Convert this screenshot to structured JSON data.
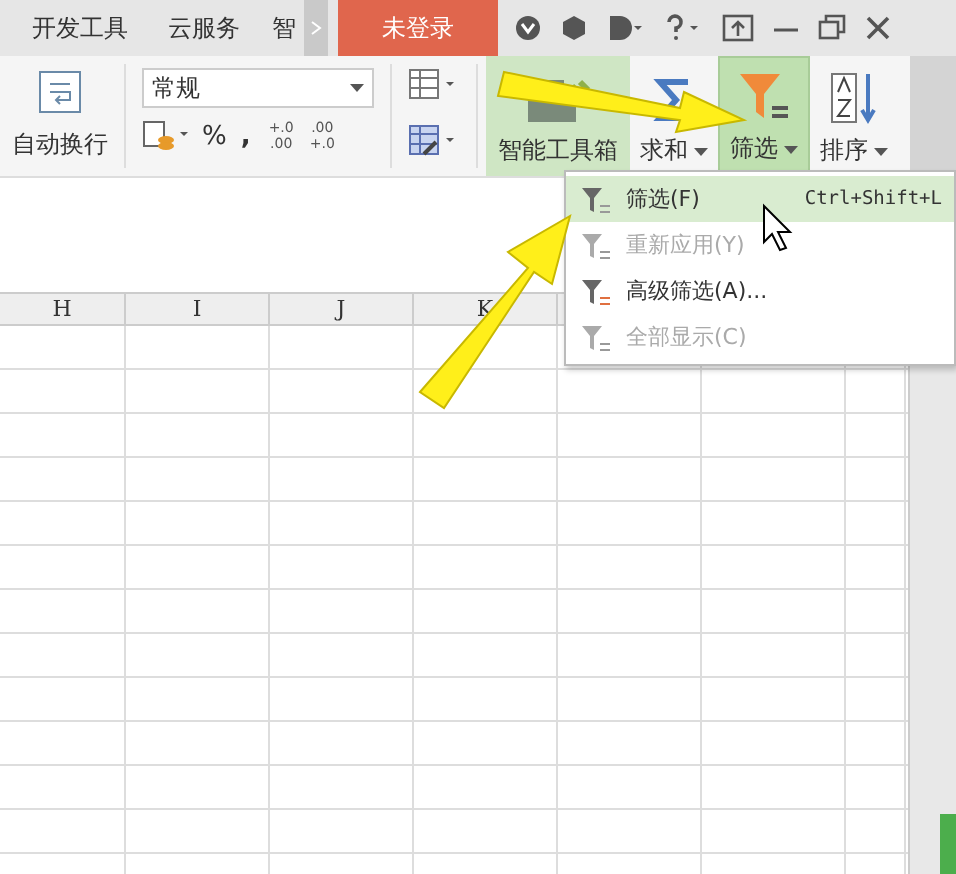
{
  "title_tabs": [
    {
      "label": "开发工具"
    },
    {
      "label": "云服务"
    },
    {
      "label": "智"
    }
  ],
  "login_button": "未登录",
  "ribbon": {
    "wrap_label": "自动换行",
    "number_format": "常规",
    "percent": "%",
    "comma": ",",
    "decimal_buttons": [
      {
        "top": "+.0",
        "bottom": ".00"
      },
      {
        "top": ".00",
        "bottom": "+.0"
      }
    ],
    "tools": [
      {
        "label": "智能工具箱",
        "kind": "toolbox",
        "selected": false
      },
      {
        "label": "求和",
        "kind": "sum",
        "selected": false
      },
      {
        "label": "筛选",
        "kind": "filter",
        "selected": true
      },
      {
        "label": "排序",
        "kind": "sort",
        "selected": false
      }
    ]
  },
  "columns": [
    "H",
    "I",
    "J",
    "K"
  ],
  "menu": [
    {
      "label": "筛选(F)",
      "shortcut": "Ctrl+Shift+L",
      "disabled": false,
      "selected": true
    },
    {
      "label": "重新应用(Y)",
      "disabled": true,
      "selected": false
    },
    {
      "label": "高级筛选(A)...",
      "disabled": false,
      "selected": false
    },
    {
      "label": "全部显示(C)",
      "disabled": true,
      "selected": false
    }
  ]
}
